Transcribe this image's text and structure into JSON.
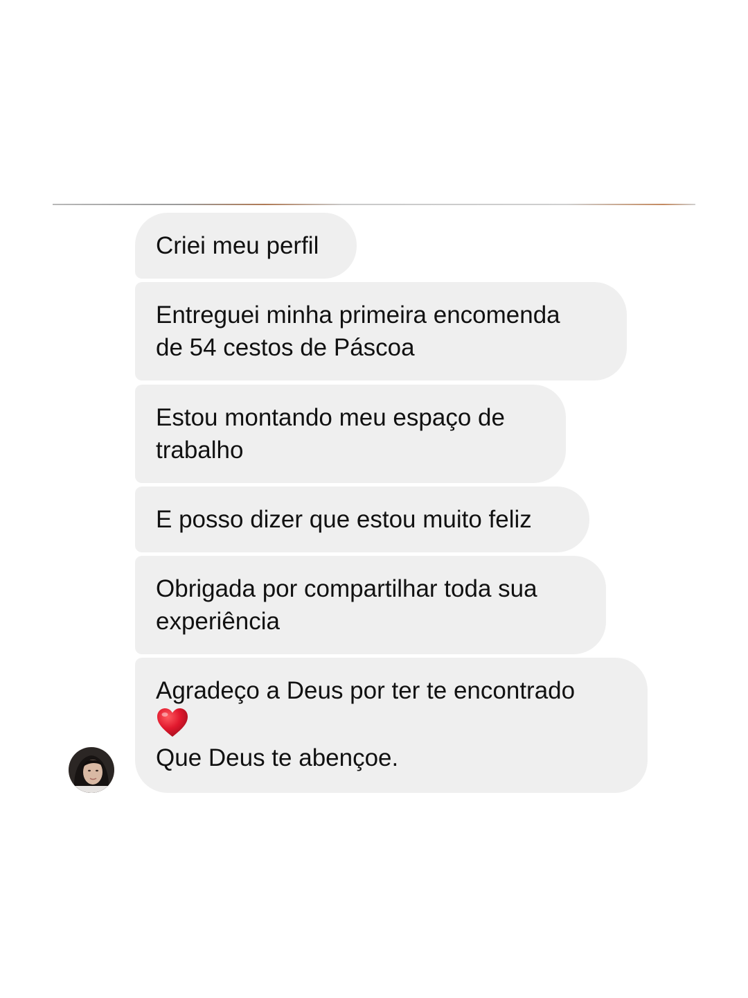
{
  "messages": [
    {
      "lines": [
        "Criei meu perfil"
      ]
    },
    {
      "lines": [
        "Entreguei minha primeira encomenda",
        "de 54 cestos de Páscoa"
      ]
    },
    {
      "lines": [
        "Estou montando meu espaço de",
        "trabalho"
      ]
    },
    {
      "lines": [
        "E posso dizer que estou muito feliz"
      ]
    },
    {
      "lines": [
        "Obrigada por compartilhar toda sua",
        "experiência"
      ]
    },
    {
      "lines": [
        "Agradeço a Deus por ter te encontrado",
        "Que Deus te abençoe."
      ],
      "emoji": "red-heart-icon"
    }
  ],
  "colors": {
    "bubble": "#efefef",
    "text": "#111111",
    "heart": "#e0182d"
  }
}
